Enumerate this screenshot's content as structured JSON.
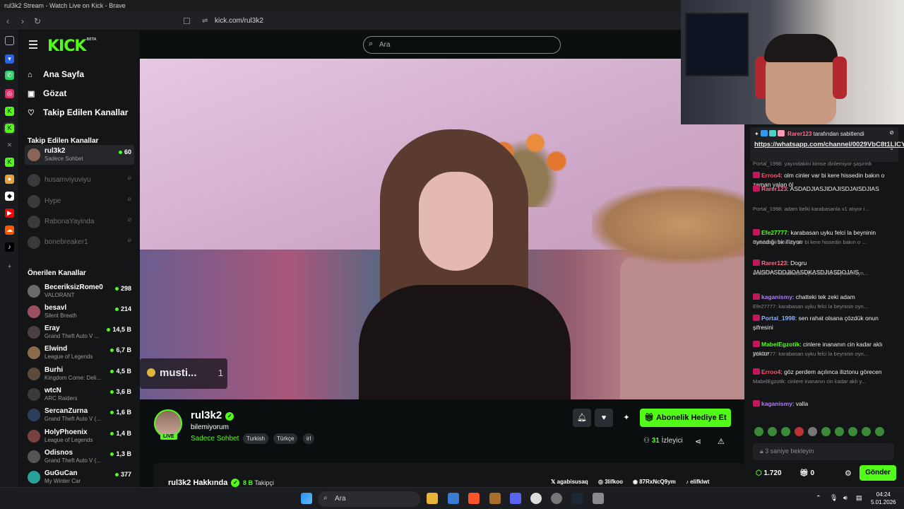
{
  "window": {
    "title": "rul3k2 Stream - Watch Live on Kick - Brave",
    "url": "kick.com/rul3k2"
  },
  "header": {
    "search_placeholder": "Ara",
    "logo": "KICK",
    "logo_badge": "BETA"
  },
  "nav": [
    {
      "label": "Ana Sayfa",
      "icon": "home-icon"
    },
    {
      "label": "Gözat",
      "icon": "browse-icon"
    },
    {
      "label": "Takip Edilen Kanallar",
      "icon": "heart-icon"
    }
  ],
  "followed": {
    "title": "Takip Edilen Kanallar",
    "channels": [
      {
        "name": "rul3k2",
        "sub": "Sadece Sohbet",
        "viewers": "60",
        "live": true
      },
      {
        "name": "husamviyuviyu",
        "live": false
      },
      {
        "name": "Hype",
        "live": false
      },
      {
        "name": "RabonaYayinda",
        "live": false
      },
      {
        "name": "bonebreaker1",
        "live": false
      }
    ]
  },
  "recommended": {
    "title": "Önerilen Kanallar",
    "channels": [
      {
        "name": "BeceriksizRome0",
        "sub": "VALORANT",
        "viewers": "298"
      },
      {
        "name": "besavl",
        "sub": "Silent Breath",
        "viewers": "214"
      },
      {
        "name": "Eray",
        "sub": "Grand Theft Auto V ...",
        "viewers": "14,5 B"
      },
      {
        "name": "Elwind",
        "sub": "League of Legends",
        "viewers": "6,7 B"
      },
      {
        "name": "Burhi",
        "sub": "Kingdom Come: Deli...",
        "viewers": "4,5 B"
      },
      {
        "name": "wtcN",
        "sub": "ARC Raiders",
        "viewers": "3,6 B"
      },
      {
        "name": "SercanZurna",
        "sub": "Grand Theft Auto V (...",
        "viewers": "1,6 B"
      },
      {
        "name": "HolyPhoenix",
        "sub": "League of Legends",
        "viewers": "1,4 B"
      },
      {
        "name": "Odisnos",
        "sub": "Grand Theft Auto V (...",
        "viewers": "1,3 B"
      },
      {
        "name": "GuGuCan",
        "sub": "My Winter Car",
        "viewers": "377"
      }
    ]
  },
  "overlay": {
    "label": "musti...",
    "count": "1"
  },
  "streamer": {
    "name": "rul3k2",
    "live_badge": "LIVE",
    "title": "bilemiyorum",
    "category": "Sadece Sohbet",
    "tags": [
      "Turkish",
      "Türkçe",
      "irl"
    ],
    "gift_sub_label": "Abonelik Hediye Et",
    "viewers_count": "31",
    "viewers_label": "İzleyici"
  },
  "about": {
    "title": "rul3k2 Hakkında",
    "followers_count": "8 B",
    "followers_label": "Takipçi",
    "socials": [
      "agabisusaq",
      "3lifkoo",
      "87RxNcQ9ym",
      "elifklwt"
    ]
  },
  "chat": {
    "pinned_by": "Rarer123",
    "pinned_suffix": "tarafından sabitlendi",
    "pinned_link": "https://whatsapp.com/channel/0029VbC8t1LlCYoYTTDCoQ33",
    "partial_top": "Portal_1998: yayındakini kimse dinlemiyor şaşırmk",
    "messages": [
      {
        "type": "msg",
        "user": "Erroo4",
        "color": "#ff4d6d",
        "text": "olm cinler var bi kere hissedin bakın o zaman yalan öl"
      },
      {
        "type": "msg",
        "user": "Rarer123",
        "color": "#ff6b8b",
        "text": "ASDADJIASJIDAJISDJAISDJIAS"
      },
      {
        "type": "reply",
        "text": "Portal_1998: adam belki karabasanla v1 atıyor i..."
      },
      {
        "type": "msg",
        "user": "Efe27777",
        "color": "#53fc18",
        "text": "karabasan uyku felci la beyninin oynadığı bir ilizyon"
      },
      {
        "type": "reply",
        "text": "Erroo4: olm cinler var bi kere hissedin bakın o ..."
      },
      {
        "type": "msg",
        "user": "Rarer123",
        "color": "#ff6b8b",
        "text": "Dogru JAISDASDDJIOASDKASDJIASDOJAIS"
      },
      {
        "type": "reply",
        "text": "Efe27777: karabasan uyku felci la beyninin oyn..."
      },
      {
        "type": "msg",
        "user": "kaganismy",
        "color": "#b07cff",
        "text": "chatteki tek zeki adam"
      },
      {
        "type": "reply",
        "text": "Efe27777: karabasan uyku felci la beyninin oyn..."
      },
      {
        "type": "msg",
        "user": "Portal_1998",
        "color": "#8cb4ff",
        "text": "sen rahat olsana çözdük onun şifresini"
      },
      {
        "type": "msg",
        "user": "MabelEgzotik",
        "color": "#53fc18",
        "text": "cinlere inananın cin kadar aklı yoktur"
      },
      {
        "type": "reply",
        "text": "Efe27777: karabasan uyku felci la beyninin oyn..."
      },
      {
        "type": "msg",
        "user": "Erroo4",
        "color": "#ff4d6d",
        "text": "göz perdem açılınca iliztonu görecen"
      },
      {
        "type": "reply",
        "text": "MabelEgzotik: cinlere inananın cin kadar aklı y..."
      },
      {
        "type": "msg",
        "user": "kaganismy",
        "color": "#b07cff",
        "text": "valla"
      }
    ],
    "input_placeholder": "3 saniye bekleyin",
    "points": "1.720",
    "points2": "0",
    "send_label": "Gönder"
  },
  "taskbar": {
    "search_placeholder": "Ara",
    "time": "04:24",
    "date": "5.01.2026"
  },
  "colors": {
    "accent": "#53fc18",
    "background": "#0b0e0f",
    "panel": "#141517"
  }
}
